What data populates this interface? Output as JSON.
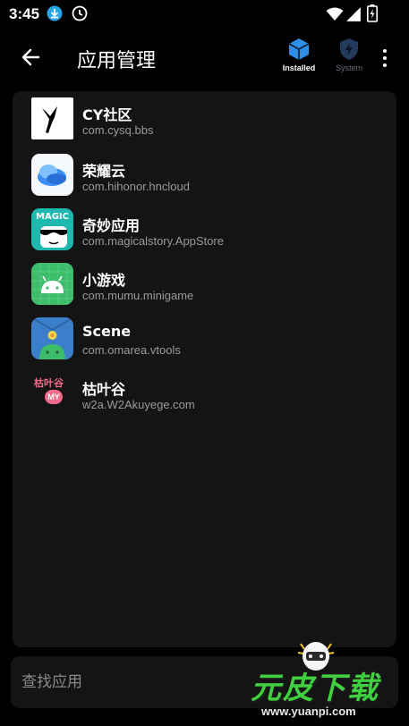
{
  "status_bar": {
    "time": "3:45",
    "icons": [
      "download-icon",
      "clock-icon",
      "wifi-icon",
      "signal-icon",
      "battery-charging-icon"
    ]
  },
  "app_bar": {
    "title": "应用管理",
    "tabs": [
      {
        "label": "Installed",
        "icon": "box-icon",
        "active": true,
        "color": "#2f8fe8"
      },
      {
        "label": "System",
        "icon": "shield-icon",
        "active": false,
        "color": "#233a5c"
      }
    ]
  },
  "apps": [
    {
      "name": "CY社区",
      "package": "com.cysq.bbs"
    },
    {
      "name": "荣耀云",
      "package": "com.hihonor.hncloud"
    },
    {
      "name": "奇妙应用",
      "package": "com.magicalstory.AppStore",
      "icon_text": "MAGIC"
    },
    {
      "name": "小游戏",
      "package": "com.mumu.minigame"
    },
    {
      "name": "Scene",
      "package": "com.omarea.vtools"
    },
    {
      "name": "枯叶谷",
      "package": "w2a.W2Akuyege.com",
      "icon_text": "枯叶谷",
      "icon_badge": "MY"
    }
  ],
  "search": {
    "placeholder": "查找应用"
  },
  "watermark": {
    "brand": "元皮下载",
    "url": "www.yuanpi.com"
  },
  "colors": {
    "background": "#000000",
    "card": "#141414",
    "accent": "#2f8fe8",
    "secondary_text": "#9a9a9a"
  }
}
